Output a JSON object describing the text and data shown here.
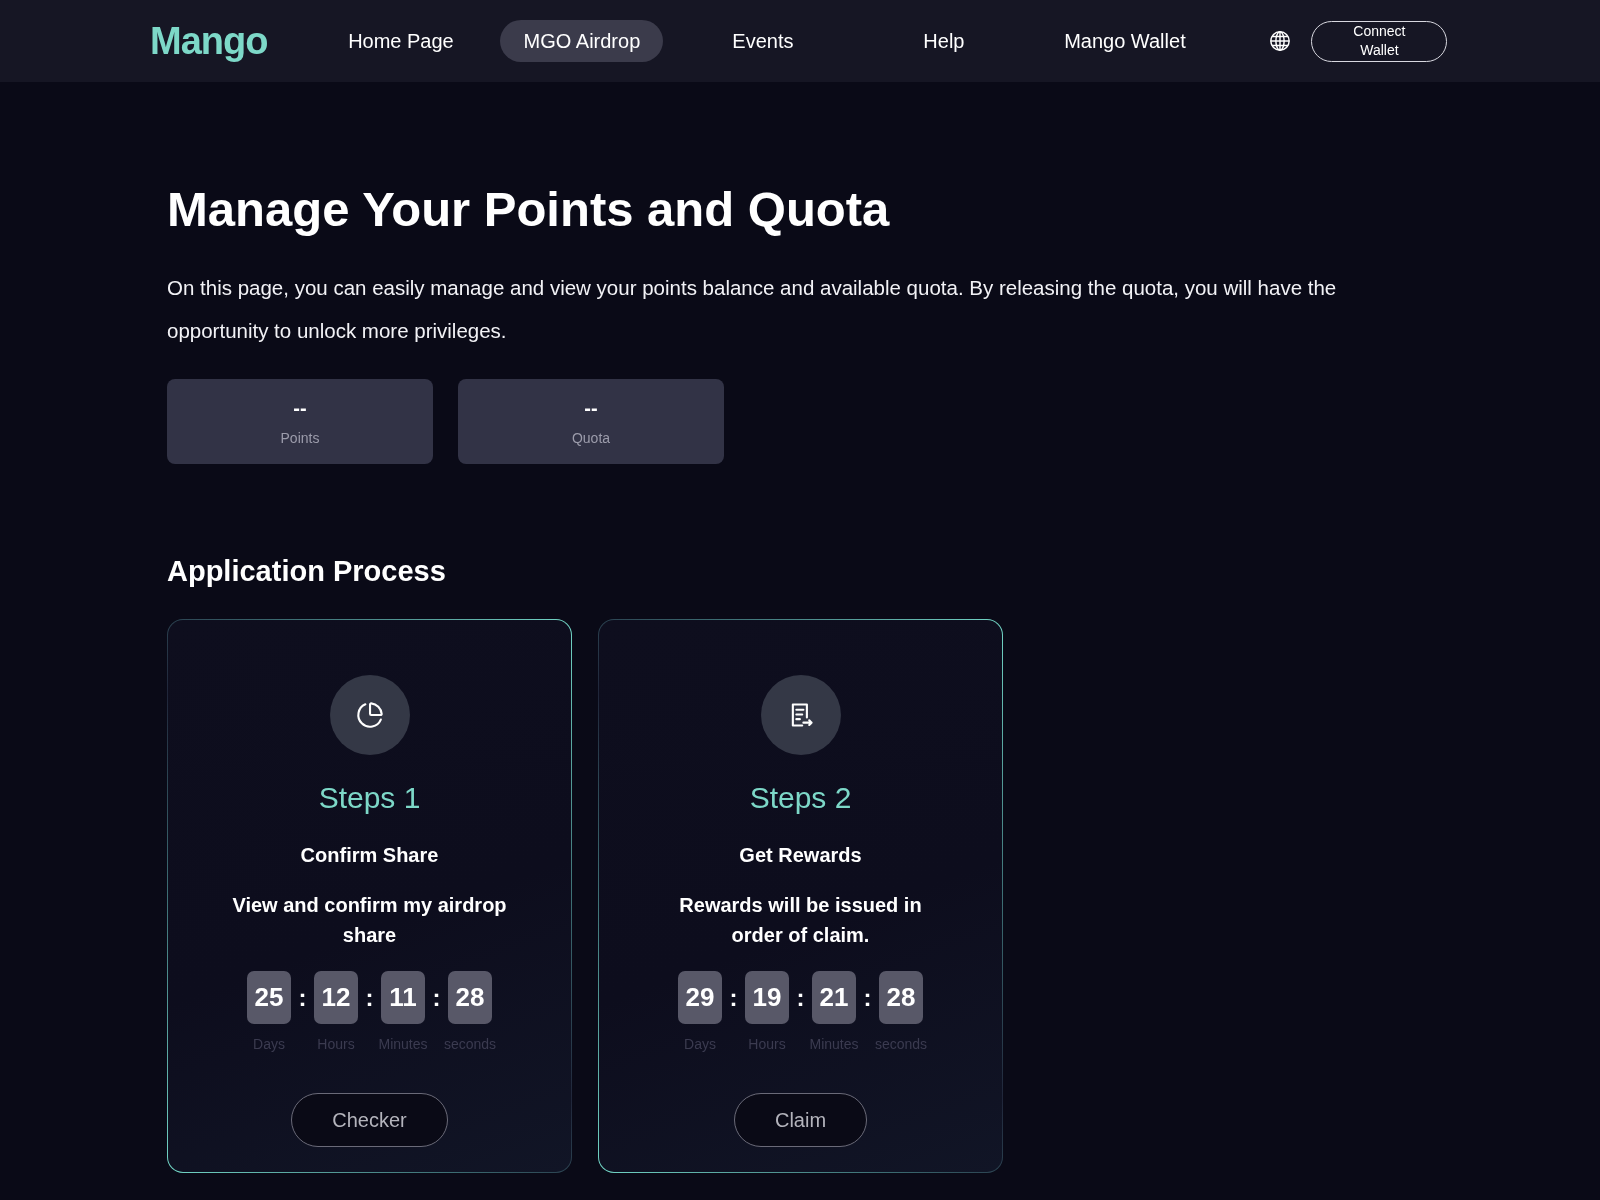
{
  "header": {
    "logo": "Mango",
    "nav": [
      {
        "label": "Home Page",
        "selected": false
      },
      {
        "label": "MGO Airdrop",
        "selected": true
      },
      {
        "label": "Events",
        "selected": false
      },
      {
        "label": "Help",
        "selected": false
      },
      {
        "label": "Mango Wallet",
        "selected": false
      }
    ],
    "connect_button": "Connect Wallet"
  },
  "hero": {
    "title": "Manage Your Points and Quota",
    "description": "On this page, you can easily manage and view your points balance and available quota. By releasing the quota, you will have the opportunity to unlock more privileges."
  },
  "stats": [
    {
      "value": "--",
      "label": "Points"
    },
    {
      "value": "--",
      "label": "Quota"
    }
  ],
  "process": {
    "heading": "Application Process",
    "steps": [
      {
        "step": "Steps 1",
        "title": "Confirm Share",
        "description": "View and confirm my airdrop share",
        "countdown": [
          {
            "value": "25",
            "unit": "Days"
          },
          {
            "value": "12",
            "unit": "Hours"
          },
          {
            "value": "11",
            "unit": "Minutes"
          },
          {
            "value": "28",
            "unit": "seconds"
          }
        ],
        "separator": ":",
        "button": "Checker"
      },
      {
        "step": "Steps 2",
        "title": "Get Rewards",
        "description": "Rewards will be issued in order of claim.",
        "countdown": [
          {
            "value": "29",
            "unit": "Days"
          },
          {
            "value": "19",
            "unit": "Hours"
          },
          {
            "value": "21",
            "unit": "Minutes"
          },
          {
            "value": "28",
            "unit": "seconds"
          }
        ],
        "separator": ":",
        "button": "Claim"
      }
    ]
  }
}
